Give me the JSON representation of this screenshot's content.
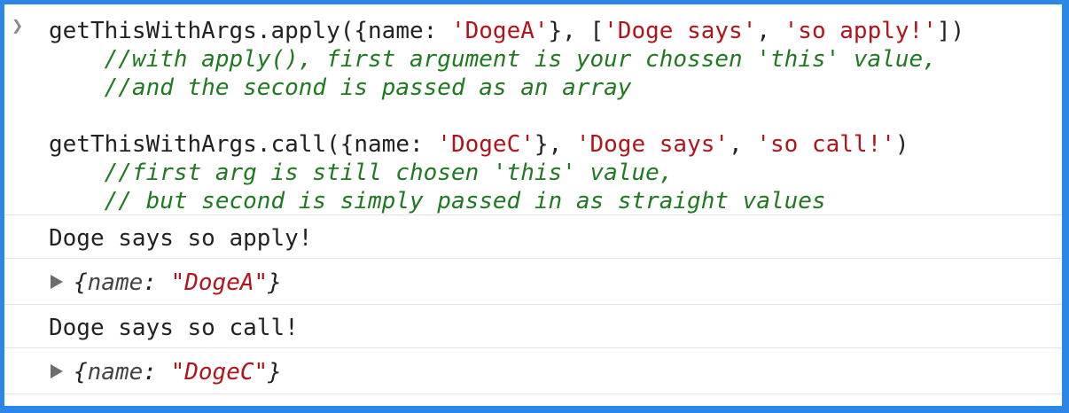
{
  "input": {
    "prompt_icon": "chevron-right-icon",
    "apply_call": {
      "fn": "getThisWithArgs.apply({name: ",
      "arg1": "'DogeA'",
      "mid": "}, [",
      "arg2": "'Doge says'",
      "sep": ", ",
      "arg3": "'so apply!'",
      "end": "])"
    },
    "apply_comment_1": "    //with apply(), first argument is your chossen 'this' value,",
    "apply_comment_2": "    //and the second is passed as an array",
    "call_call": {
      "fn": "getThisWithArgs.call({name: ",
      "arg1": "'DogeC'",
      "mid": "}, ",
      "arg2": "'Doge says'",
      "sep": ", ",
      "arg3": "'so call!'",
      "end": ")"
    },
    "call_comment_1": "    //first arg is still chosen 'this' value,",
    "call_comment_2": "    // but second is simply passed in as straight values"
  },
  "output": {
    "log1": "Doge says so apply!",
    "obj1": {
      "open": "{",
      "key": "name",
      "colon": ": ",
      "value": "\"DogeA\"",
      "close": "}"
    },
    "log2": "Doge says so call!",
    "obj2": {
      "open": "{",
      "key": "name",
      "colon": ": ",
      "value": "\"DogeC\"",
      "close": "}"
    }
  },
  "colors": {
    "border": "#2b86e8",
    "string": "#b3131b",
    "comment": "#1f7a1f"
  }
}
